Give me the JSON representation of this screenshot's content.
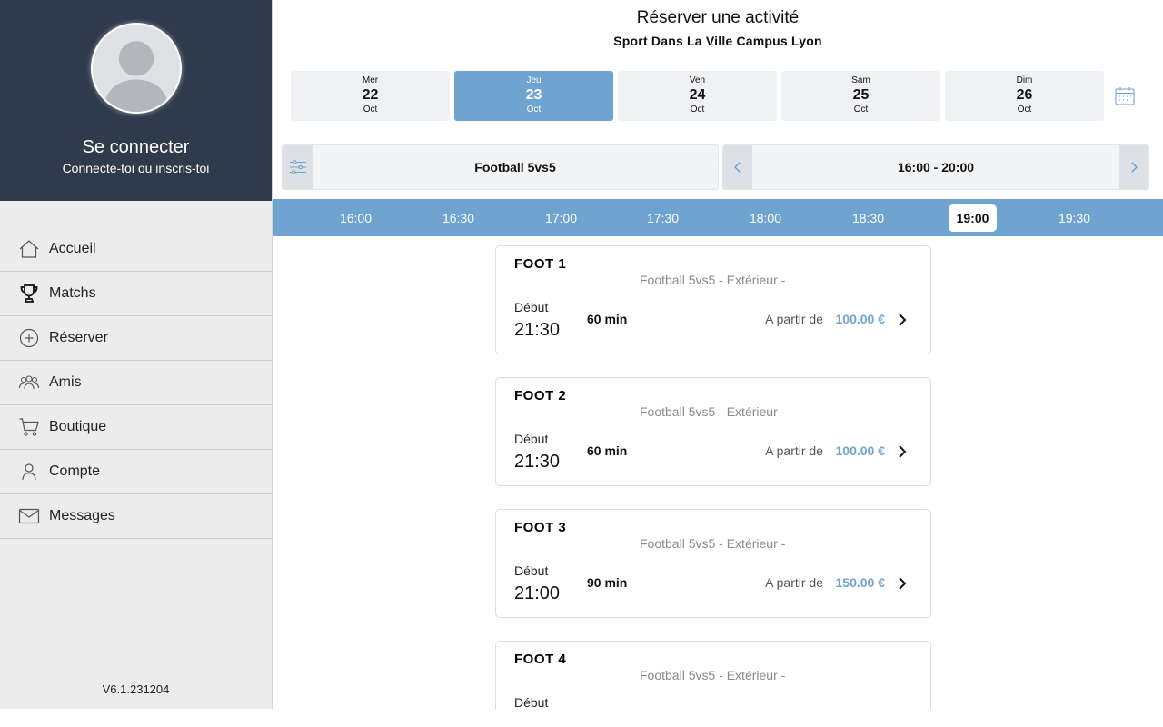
{
  "sidebar": {
    "login_title": "Se connecter",
    "login_subtitle": "Connecte-toi ou inscris-toi",
    "items": [
      {
        "label": "Accueil",
        "icon": "home-icon"
      },
      {
        "label": "Matchs",
        "icon": "trophy-icon"
      },
      {
        "label": "Réserver",
        "icon": "plus-circle-icon"
      },
      {
        "label": "Amis",
        "icon": "friends-icon"
      },
      {
        "label": "Boutique",
        "icon": "cart-icon"
      },
      {
        "label": "Compte",
        "icon": "user-icon"
      },
      {
        "label": "Messages",
        "icon": "mail-icon"
      }
    ],
    "version": "V6.1.231204"
  },
  "header": {
    "title": "Réserver une activité",
    "venue": "Sport Dans La Ville Campus Lyon"
  },
  "days": [
    {
      "name": "Mer",
      "num": "22",
      "month": "Oct",
      "selected": false
    },
    {
      "name": "Jeu",
      "num": "23",
      "month": "Oct",
      "selected": true
    },
    {
      "name": "Ven",
      "num": "24",
      "month": "Oct",
      "selected": false
    },
    {
      "name": "Sam",
      "num": "25",
      "month": "Oct",
      "selected": false
    },
    {
      "name": "Dim",
      "num": "26",
      "month": "Oct",
      "selected": false
    }
  ],
  "filter": {
    "label": "Football 5vs5",
    "icon": "sliders-icon"
  },
  "time_range": {
    "label": "16:00 - 20:00"
  },
  "slots": [
    {
      "label": "16:00",
      "active": false
    },
    {
      "label": "16:30",
      "active": false
    },
    {
      "label": "17:00",
      "active": false
    },
    {
      "label": "17:30",
      "active": false
    },
    {
      "label": "18:00",
      "active": false
    },
    {
      "label": "18:30",
      "active": false
    },
    {
      "label": "19:00",
      "active": true
    },
    {
      "label": "19:30",
      "active": false
    }
  ],
  "courts": [
    {
      "name": "FOOT 1",
      "type": "Football 5vs5 - Extérieur  -",
      "start_label": "Début",
      "start": "21:30",
      "duration": "60 min",
      "from_label": "A partir de",
      "price": "100.00 €"
    },
    {
      "name": "FOOT 2",
      "type": "Football 5vs5 - Extérieur  -",
      "start_label": "Début",
      "start": "21:30",
      "duration": "60 min",
      "from_label": "A partir de",
      "price": "100.00 €"
    },
    {
      "name": "FOOT 3",
      "type": "Football 5vs5 - Extérieur  -",
      "start_label": "Début",
      "start": "21:00",
      "duration": "90 min",
      "from_label": "A partir de",
      "price": "150.00 €"
    },
    {
      "name": "FOOT 4",
      "type": "Football 5vs5 - Extérieur  -",
      "start_label": "Début",
      "start": "",
      "duration": "",
      "from_label": "",
      "price": ""
    }
  ],
  "colors": {
    "accent": "#6fa3d0",
    "sidebar_header": "#2f3a4a",
    "sidebar_bg": "#ececec"
  }
}
